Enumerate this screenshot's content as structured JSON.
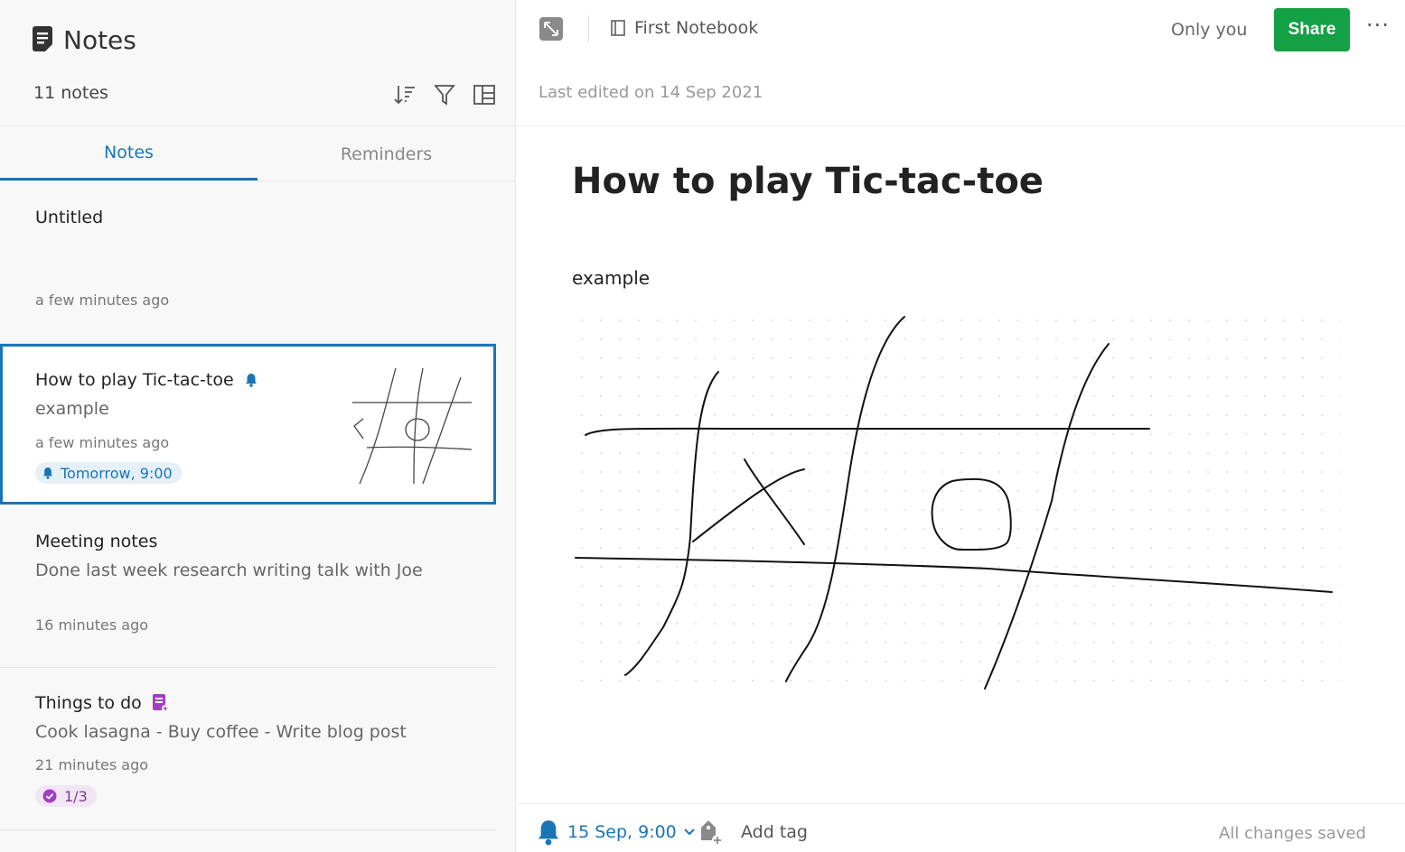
{
  "sidebar": {
    "title": "Notes",
    "count": "11 notes",
    "tabs": [
      {
        "label": "Notes",
        "active": true
      },
      {
        "label": "Reminders",
        "active": false
      }
    ],
    "notes": [
      {
        "title": "Untitled",
        "snippet": "",
        "time": "a few minutes ago"
      },
      {
        "title": "How to play Tic-tac-toe",
        "snippet": "example",
        "time": "a few minutes ago",
        "reminder": "Tomorrow, 9:00",
        "selected": true
      },
      {
        "title": "Meeting notes",
        "snippet": "Done last week research writing talk with Joe",
        "time": "16 minutes ago"
      },
      {
        "title": "Things to do",
        "snippet": "Cook lasagna - Buy coffee - Write blog post",
        "time": "21 minutes ago",
        "task_progress": "1/3"
      }
    ]
  },
  "editor": {
    "notebook": "First Notebook",
    "visibility": "Only you",
    "share_label": "Share",
    "more_label": "···",
    "last_edited": "Last edited on 14 Sep 2021",
    "title": "How to play Tic-tac-toe",
    "body_text": "example",
    "reminder_date": "15 Sep, 9:00",
    "add_tag": "Add tag",
    "save_status": "All changes saved"
  },
  "colors": {
    "accent": "#1a75b5",
    "share": "#14a044",
    "task": "#a23fc0"
  },
  "icons": [
    "notes-icon",
    "sort-icon",
    "filter-icon",
    "layout-icon",
    "bell-icon",
    "task-icon",
    "check-circle-icon",
    "expand-icon",
    "notebook-icon",
    "tag-add-icon",
    "chevron-down-icon"
  ]
}
